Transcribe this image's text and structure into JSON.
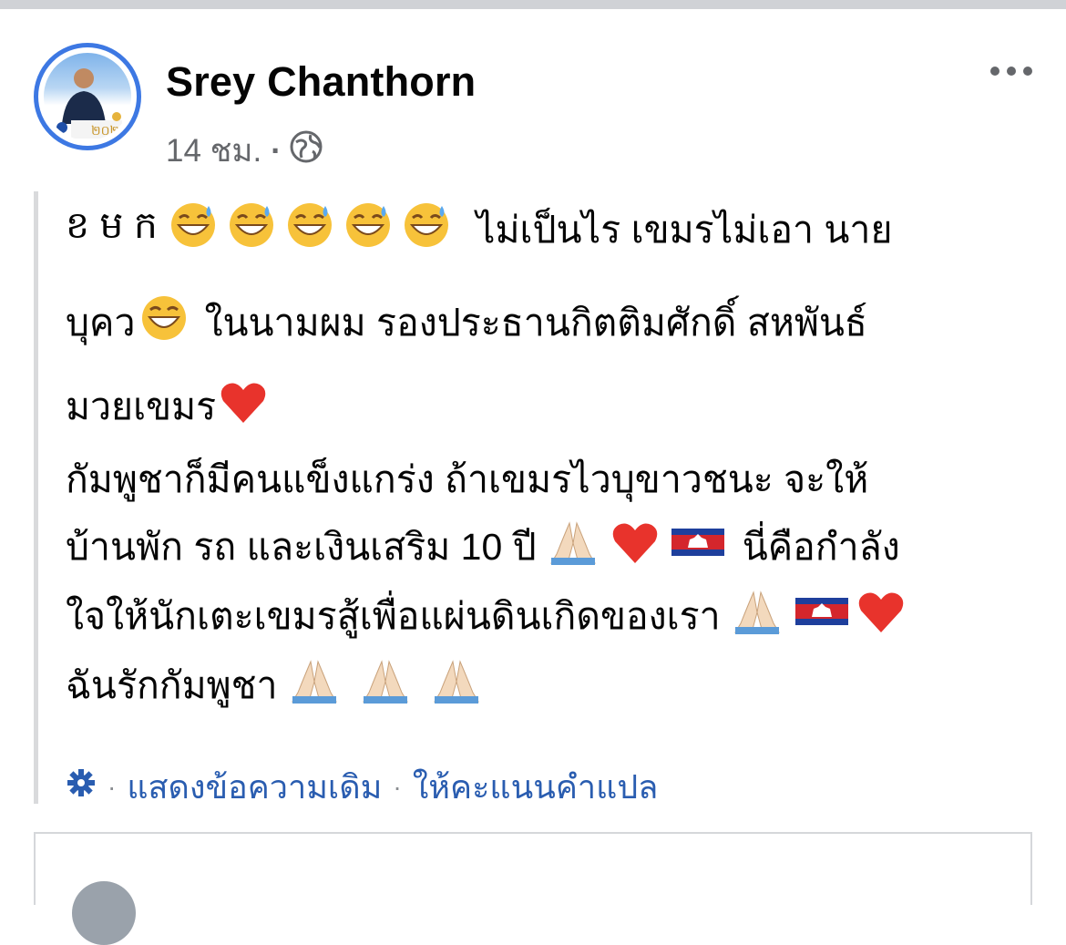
{
  "post": {
    "author": "Srey Chanthorn",
    "time": "14 ชม.",
    "privacy_icon": "globe-icon",
    "more_icon": "more-dots-icon",
    "text_lines": [
      [
        "ខ ម ក",
        "[grin-sweat x5]",
        "ไม่เป็นไร เขมรไม่เอา นาย"
      ],
      [
        "บุคว",
        "[grin]",
        "ในนามผม รองประธานกิตติมศักดิ์ สหพันธ์"
      ],
      [
        "มวยเขมร",
        "[heart]"
      ],
      [
        "กัมพูชาก็มีคนแข็งแกร่ง ถ้าเขมรไวบุขาวชนะ จะให้"
      ],
      [
        "บ้านพัก รถ และเงินเสริม 10 ปี",
        "[pray heart flag]",
        "นี่คือกำลัง"
      ],
      [
        "ใจให้นักเตะเขมรสู้เพื่อแผ่นดินเกิดของเรา",
        "[pray flag heart]"
      ],
      [
        "ฉันรักกัมพูชา",
        "[pray x3]"
      ]
    ],
    "line1_a": "ខ ម ក",
    "line1_b": "ไม่เป็นไร เขมรไม่เอา นาย",
    "line2_a": "บุคว",
    "line2_b": "ในนามผม รองประธานกิตติมศักดิ์ สหพันธ์",
    "line3_a": "มวยเขมร",
    "line4_a": "กัมพูชาก็มีคนแข็งแกร่ง ถ้าเขมรไวบุขาวชนะ จะให้",
    "line5_a": "บ้านพัก รถ และเงินเสริม 10 ปี",
    "line5_b": "นี่คือกำลัง",
    "line6_a": "ใจให้นักเตะเขมรสู้เพื่อแผ่นดินเกิดของเรา",
    "line7_a": "ฉันรักกัมพูชา"
  },
  "translation": {
    "gear_icon": "gear-icon",
    "show_original": "แสดงข้อความเดิม",
    "rate_translation": "ให้คะแนนคำแปล"
  },
  "colors": {
    "link": "#2a5db0",
    "avatar_ring": "#3d78e3",
    "meta": "#65676b"
  }
}
